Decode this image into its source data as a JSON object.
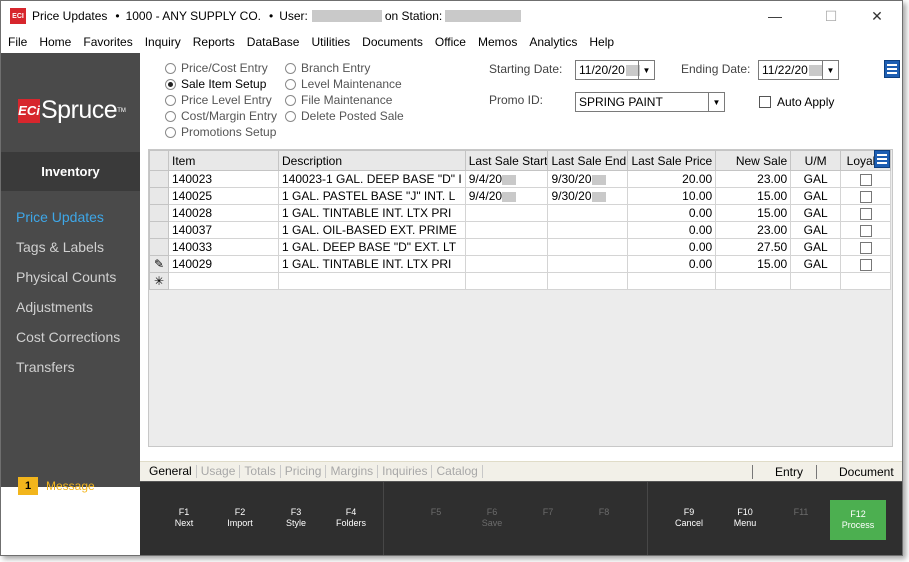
{
  "window": {
    "app_icon": "ECI",
    "title": "Price Updates",
    "bullet": "•",
    "company": "1000 - ANY SUPPLY CO.",
    "user_label": "User:",
    "station_label": "on Station:",
    "minimize": "—",
    "maximize": "☐",
    "close": "✕"
  },
  "menu": [
    "File",
    "Home",
    "Favorites",
    "Inquiry",
    "Reports",
    "DataBase",
    "Utilities",
    "Documents",
    "Office",
    "Memos",
    "Analytics",
    "Help"
  ],
  "sidebar": {
    "logo_eci": "ECi",
    "logo_name": "Spruce",
    "logo_tm": "TM",
    "section": "Inventory",
    "items": [
      {
        "label": "Price Updates",
        "active": true
      },
      {
        "label": "Tags & Labels",
        "active": false
      },
      {
        "label": "Physical Counts",
        "active": false
      },
      {
        "label": "Adjustments",
        "active": false
      },
      {
        "label": "Cost Corrections",
        "active": false
      },
      {
        "label": "Transfers",
        "active": false
      }
    ],
    "message_count": "1",
    "message_label": "Message"
  },
  "options": {
    "col1": [
      "Price/Cost Entry",
      "Sale Item Setup",
      "Price Level Entry",
      "Cost/Margin Entry",
      "Promotions Setup"
    ],
    "col2": [
      "Branch Entry",
      "Level Maintenance",
      "File Maintenance",
      "Delete Posted Sale"
    ],
    "selected": "Sale Item Setup"
  },
  "form": {
    "starting_date_label": "Starting Date:",
    "starting_date": "11/20/20",
    "ending_date_label": "Ending Date:",
    "ending_date": "11/22/20",
    "promo_id_label": "Promo ID:",
    "promo_id": "SPRING PAINT",
    "auto_apply_label": "Auto Apply",
    "auto_apply_checked": false
  },
  "grid": {
    "columns": [
      "Item",
      "Description",
      "Last Sale Start",
      "Last Sale End",
      "Last Sale Price",
      "New Sale",
      "U/M",
      "Loyalty"
    ],
    "rows": [
      {
        "marker": "",
        "item": "140023",
        "description": "140023-1 GAL. DEEP BASE \"D\" I",
        "start": "9/4/20",
        "end": "9/30/20",
        "last_price": "20.00",
        "new_sale": "23.00",
        "um": "GAL"
      },
      {
        "marker": "",
        "item": "140025",
        "description": "1 GAL. PASTEL BASE \"J\" INT. L",
        "start": "9/4/20",
        "end": "9/30/20",
        "last_price": "10.00",
        "new_sale": "15.00",
        "um": "GAL"
      },
      {
        "marker": "",
        "item": "140028",
        "description": "1 GAL. TINTABLE INT. LTX PRI",
        "start": "",
        "end": "",
        "last_price": "0.00",
        "new_sale": "15.00",
        "um": "GAL"
      },
      {
        "marker": "",
        "item": "140037",
        "description": "1 GAL. OIL-BASED EXT. PRIME",
        "start": "",
        "end": "",
        "last_price": "0.00",
        "new_sale": "23.00",
        "um": "GAL"
      },
      {
        "marker": "",
        "item": "140033",
        "description": "1 GAL. DEEP BASE \"D\" EXT. LT",
        "start": "",
        "end": "",
        "last_price": "0.00",
        "new_sale": "27.50",
        "um": "GAL"
      },
      {
        "marker": "✎",
        "item": "140029",
        "description": "1 GAL. TINTABLE INT. LTX PRI",
        "start": "",
        "end": "",
        "last_price": "0.00",
        "new_sale": "15.00",
        "um": "GAL"
      }
    ],
    "new_row_marker": "✳"
  },
  "tabs": [
    "General",
    "Usage",
    "Totals",
    "Pricing",
    "Margins",
    "Inquiries",
    "Catalog"
  ],
  "tab_right": [
    "Entry",
    "Document"
  ],
  "fkeys": [
    {
      "key": "F1",
      "label": "Next",
      "enabled": true
    },
    {
      "key": "F2",
      "label": "Import",
      "enabled": true
    },
    {
      "key": "F3",
      "label": "Style",
      "enabled": true
    },
    {
      "key": "F4",
      "label": "Folders",
      "enabled": true
    },
    {
      "key": "F5",
      "label": "",
      "enabled": false
    },
    {
      "key": "F6",
      "label": "Save",
      "enabled": false
    },
    {
      "key": "F7",
      "label": "",
      "enabled": false
    },
    {
      "key": "F8",
      "label": "",
      "enabled": false
    },
    {
      "key": "F9",
      "label": "Cancel",
      "enabled": true
    },
    {
      "key": "F10",
      "label": "Menu",
      "enabled": true
    },
    {
      "key": "F11",
      "label": "",
      "enabled": false
    },
    {
      "key": "F12",
      "label": "Process",
      "enabled": true
    }
  ],
  "colors": {
    "sidebar_bg": "#4a4a4a",
    "active_link": "#3ea7e8",
    "message": "#f2b51c",
    "process_button": "#4caf50",
    "brand_red": "#d7262d"
  }
}
